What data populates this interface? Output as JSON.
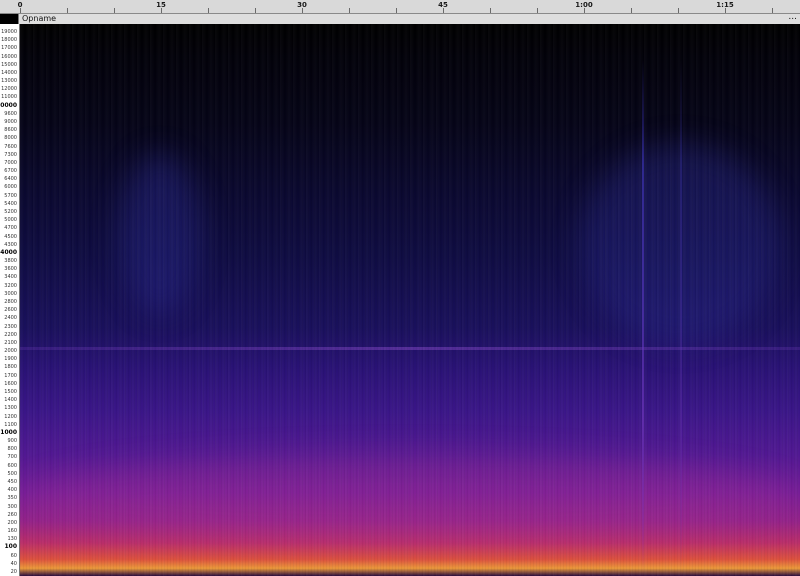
{
  "ruler": {
    "labels": [
      {
        "text": "0",
        "time_s": 0
      },
      {
        "text": "15",
        "time_s": 15
      },
      {
        "text": "30",
        "time_s": 30
      },
      {
        "text": "45",
        "time_s": 45
      },
      {
        "text": "1:00",
        "time_s": 60
      },
      {
        "text": "1:15",
        "time_s": 75
      }
    ],
    "visible_range_s": [
      0,
      83
    ]
  },
  "track": {
    "name": "Opname",
    "menu_label": "..."
  },
  "frequency_scale": {
    "unit": "Hz",
    "range": [
      20,
      20000
    ],
    "labels": [
      {
        "text": "19000",
        "hz": 19000
      },
      {
        "text": "18000",
        "hz": 18000
      },
      {
        "text": "17000",
        "hz": 17000
      },
      {
        "text": "16000",
        "hz": 16000
      },
      {
        "text": "15000",
        "hz": 15000
      },
      {
        "text": "14000",
        "hz": 14000
      },
      {
        "text": "13000",
        "hz": 13000
      },
      {
        "text": "12000",
        "hz": 12000
      },
      {
        "text": "11000",
        "hz": 11000
      },
      {
        "text": "10000",
        "hz": 10000,
        "major": true
      },
      {
        "text": "9600",
        "hz": 9600
      },
      {
        "text": "9000",
        "hz": 9000
      },
      {
        "text": "8600",
        "hz": 8600
      },
      {
        "text": "8000",
        "hz": 8000
      },
      {
        "text": "7600",
        "hz": 7600
      },
      {
        "text": "7300",
        "hz": 7300
      },
      {
        "text": "7000",
        "hz": 7000
      },
      {
        "text": "6700",
        "hz": 6700
      },
      {
        "text": "6400",
        "hz": 6400
      },
      {
        "text": "6000",
        "hz": 6000
      },
      {
        "text": "5700",
        "hz": 5700
      },
      {
        "text": "5400",
        "hz": 5400
      },
      {
        "text": "5200",
        "hz": 5200
      },
      {
        "text": "5000",
        "hz": 5000
      },
      {
        "text": "4700",
        "hz": 4700
      },
      {
        "text": "4500",
        "hz": 4500
      },
      {
        "text": "4300",
        "hz": 4300
      },
      {
        "text": "4000",
        "hz": 4000,
        "major": true
      },
      {
        "text": "3800",
        "hz": 3800
      },
      {
        "text": "3600",
        "hz": 3600
      },
      {
        "text": "3400",
        "hz": 3400
      },
      {
        "text": "3200",
        "hz": 3200
      },
      {
        "text": "3000",
        "hz": 3000
      },
      {
        "text": "2800",
        "hz": 2800
      },
      {
        "text": "2600",
        "hz": 2600
      },
      {
        "text": "2400",
        "hz": 2400
      },
      {
        "text": "2300",
        "hz": 2300
      },
      {
        "text": "2200",
        "hz": 2200
      },
      {
        "text": "2100",
        "hz": 2100
      },
      {
        "text": "2000",
        "hz": 2000
      },
      {
        "text": "1900",
        "hz": 1900
      },
      {
        "text": "1800",
        "hz": 1800
      },
      {
        "text": "1700",
        "hz": 1700
      },
      {
        "text": "1600",
        "hz": 1600
      },
      {
        "text": "1500",
        "hz": 1500
      },
      {
        "text": "1400",
        "hz": 1400
      },
      {
        "text": "1300",
        "hz": 1300
      },
      {
        "text": "1200",
        "hz": 1200
      },
      {
        "text": "1100",
        "hz": 1100
      },
      {
        "text": "1000",
        "hz": 1000,
        "major": true
      },
      {
        "text": "900",
        "hz": 900
      },
      {
        "text": "800",
        "hz": 800
      },
      {
        "text": "700",
        "hz": 700
      },
      {
        "text": "600",
        "hz": 600
      },
      {
        "text": "500",
        "hz": 500
      },
      {
        "text": "450",
        "hz": 450
      },
      {
        "text": "400",
        "hz": 400
      },
      {
        "text": "350",
        "hz": 350
      },
      {
        "text": "300",
        "hz": 300
      },
      {
        "text": "260",
        "hz": 260
      },
      {
        "text": "200",
        "hz": 200
      },
      {
        "text": "160",
        "hz": 160
      },
      {
        "text": "130",
        "hz": 130
      },
      {
        "text": "100",
        "hz": 100,
        "major": true
      },
      {
        "text": "60",
        "hz": 60
      },
      {
        "text": "40",
        "hz": 40
      },
      {
        "text": "20",
        "hz": 20
      }
    ]
  },
  "colors": {
    "ruler_bg": "#d9d9d9",
    "track_header_bg": "#dedede",
    "scale_bg": "#ffffff",
    "spectrogram_low": "#000000",
    "spectrogram_mid": "#3c168e",
    "spectrogram_high": "#f7a03c"
  }
}
